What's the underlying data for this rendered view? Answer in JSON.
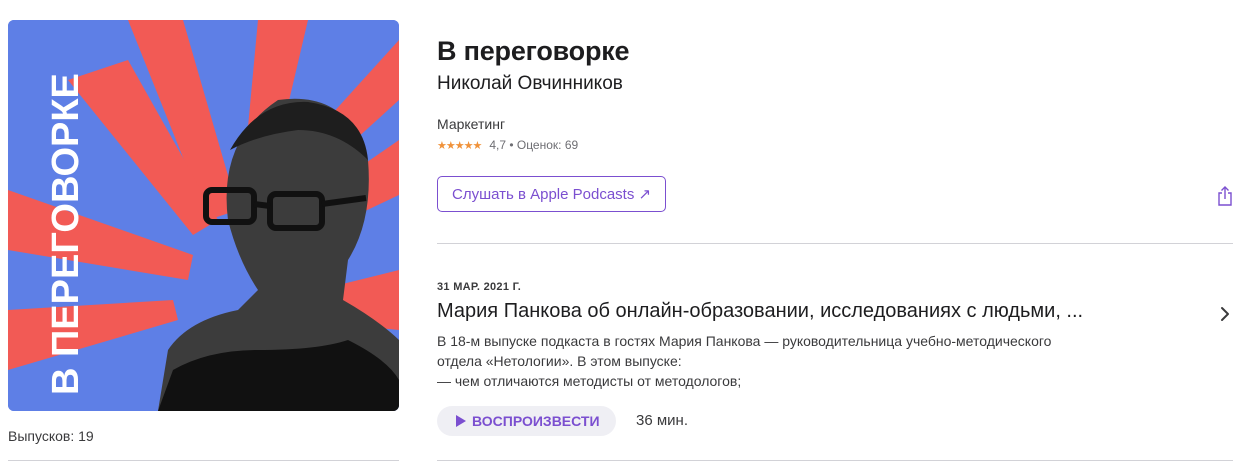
{
  "podcast": {
    "title": "В переговорке",
    "author": "Николай Овчинников",
    "category": "Маркетинг",
    "stars": "★★★★★",
    "rating_text": "4,7 • Оценок: 69",
    "episodes_count": "Выпусков: 19",
    "artwork_text": "В ПЕРЕГОВОРКЕ"
  },
  "actions": {
    "listen_label": "Слушать в Apple Podcasts ↗"
  },
  "episode": {
    "date": "31 МАР. 2021 Г.",
    "title": "Мария Панкова об онлайн-образовании, исследованиях с людьми, ...",
    "description_lines": [
      "В 18-м выпуске подкаста в гостях Мария Панкова — руководительница учебно-методического",
      "отдела «Нетологии». В этом выпуске:",
      "— чем отличаются методисты от методологов;"
    ],
    "play_label": "ВОСПРОИЗВЕСТИ",
    "duration": "36 мин."
  },
  "colors": {
    "accent": "#7b4fd0",
    "artwork_blue": "#5e7fe6",
    "artwork_red": "#f25a55",
    "stars": "#f0923a"
  },
  "icons": [
    "share-icon",
    "chevron-right-icon",
    "play-icon",
    "star-icon"
  ]
}
